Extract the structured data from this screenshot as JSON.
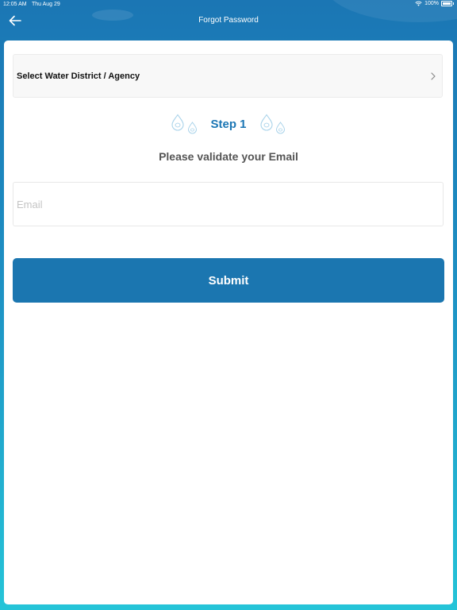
{
  "status_bar": {
    "time": "12:05 AM",
    "date": "Thu Aug 29",
    "battery": "100%"
  },
  "nav": {
    "title": "Forgot Password",
    "back_icon": "arrow-left-icon"
  },
  "form": {
    "agency_select_label": "Select Water District / Agency",
    "step_label": "Step 1",
    "subtitle": "Please validate your Email",
    "email_placeholder": "Email",
    "email_value": "",
    "submit_label": "Submit"
  },
  "colors": {
    "primary": "#1b76b0",
    "gradient_top": "#1b76b4",
    "gradient_bottom": "#25c4d8",
    "step_text": "#1b76b4"
  }
}
